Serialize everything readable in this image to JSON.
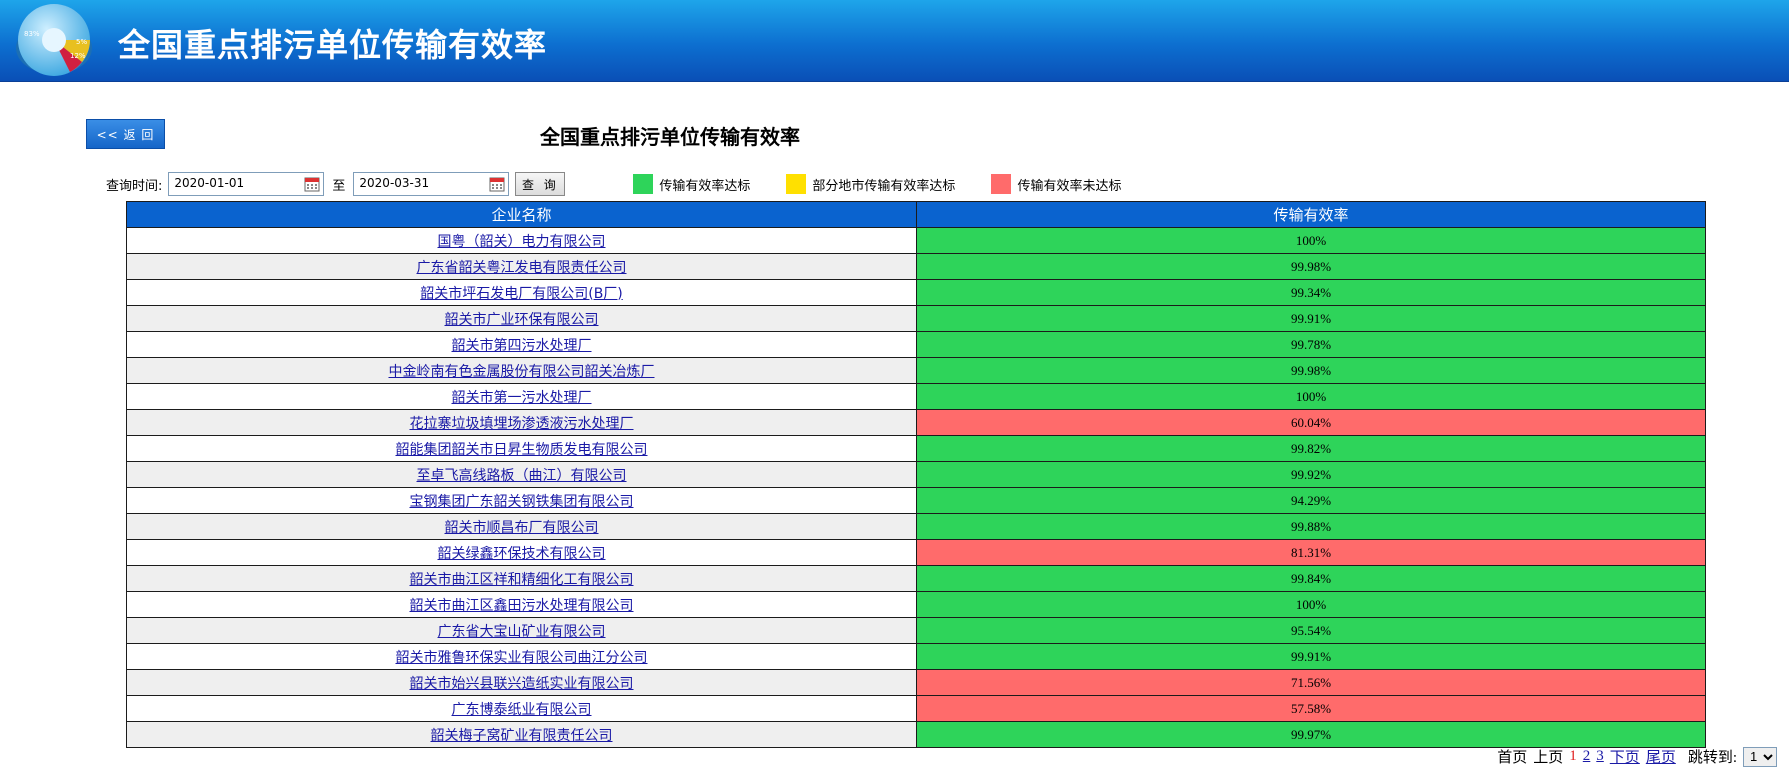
{
  "header": {
    "title": "全国重点排污单位传输有效率",
    "logo": {
      "labels": [
        "83%",
        "5%",
        "12%"
      ]
    }
  },
  "back_button": "<< 返 回",
  "page_title": "全国重点排污单位传输有效率",
  "query": {
    "label": "查询时间:",
    "start_date": "2020-01-01",
    "to_label": "至",
    "end_date": "2020-03-31",
    "button": "查 询"
  },
  "legend": [
    {
      "label": "传输有效率达标",
      "color": "#2ed45a"
    },
    {
      "label": "部分地市传输有效率达标",
      "color": "#ffe000"
    },
    {
      "label": "传输有效率未达标",
      "color": "#ff6b6b"
    }
  ],
  "table": {
    "headers": [
      "企业名称",
      "传输有效率"
    ],
    "rows": [
      {
        "name": "国粤（韶关）电力有限公司",
        "rate": "100%",
        "status": "green"
      },
      {
        "name": "广东省韶关粤江发电有限责任公司",
        "rate": "99.98%",
        "status": "green"
      },
      {
        "name": "韶关市坪石发电厂有限公司(B厂)",
        "rate": "99.34%",
        "status": "green"
      },
      {
        "name": "韶关市广业环保有限公司",
        "rate": "99.91%",
        "status": "green"
      },
      {
        "name": "韶关市第四污水处理厂",
        "rate": "99.78%",
        "status": "green"
      },
      {
        "name": "中金岭南有色金属股份有限公司韶关冶炼厂",
        "rate": "99.98%",
        "status": "green"
      },
      {
        "name": "韶关市第一污水处理厂",
        "rate": "100%",
        "status": "green"
      },
      {
        "name": "花拉寨垃圾填埋场渗透液污水处理厂",
        "rate": "60.04%",
        "status": "red"
      },
      {
        "name": "韶能集团韶关市日昇生物质发电有限公司",
        "rate": "99.82%",
        "status": "green"
      },
      {
        "name": "至卓飞高线路板（曲江）有限公司",
        "rate": "99.92%",
        "status": "green"
      },
      {
        "name": "宝钢集团广东韶关钢铁集团有限公司",
        "rate": "94.29%",
        "status": "green"
      },
      {
        "name": "韶关市顺昌布厂有限公司",
        "rate": "99.88%",
        "status": "green"
      },
      {
        "name": "韶关绿鑫环保技术有限公司",
        "rate": "81.31%",
        "status": "red"
      },
      {
        "name": "韶关市曲江区祥和精细化工有限公司",
        "rate": "99.84%",
        "status": "green"
      },
      {
        "name": "韶关市曲江区鑫田污水处理有限公司",
        "rate": "100%",
        "status": "green"
      },
      {
        "name": "广东省大宝山矿业有限公司",
        "rate": "95.54%",
        "status": "green"
      },
      {
        "name": "韶关市雅鲁环保实业有限公司曲江分公司",
        "rate": "99.91%",
        "status": "green"
      },
      {
        "name": "韶关市始兴县联兴造纸实业有限公司",
        "rate": "71.56%",
        "status": "red"
      },
      {
        "name": "广东博泰纸业有限公司",
        "rate": "57.58%",
        "status": "red"
      },
      {
        "name": "韶关梅子窝矿业有限责任公司",
        "rate": "99.97%",
        "status": "green"
      }
    ]
  },
  "pager": {
    "first": "首页",
    "prev": "上页",
    "pages": [
      "1",
      "2",
      "3"
    ],
    "current": "1",
    "next": "下页",
    "last": "尾页",
    "jump_label": "跳转到:",
    "jump_value": "1"
  }
}
